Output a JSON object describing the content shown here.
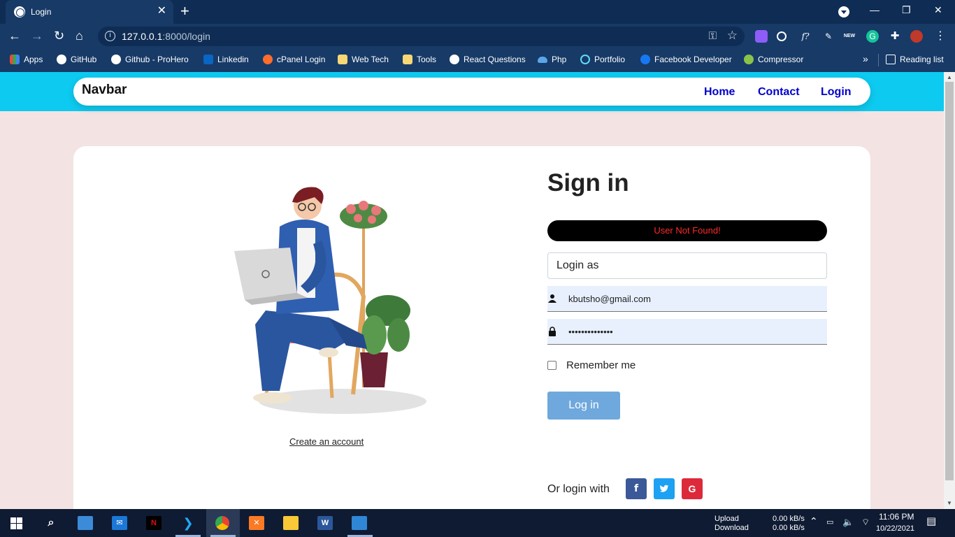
{
  "browser": {
    "tab_title": "Login",
    "tab_close": "✕",
    "new_tab": "+",
    "url_host": "127.0.0.1",
    "url_path": ":8000/login",
    "window_controls": [
      "—",
      "❐",
      "✕"
    ]
  },
  "bookmarks": {
    "items": [
      {
        "label": "Apps",
        "icon": "apps-grid-icon",
        "color": "#e84a3c"
      },
      {
        "label": "GitHub",
        "icon": "github-icon",
        "color": "#ffffff"
      },
      {
        "label": "Github - ProHero",
        "icon": "github-icon",
        "color": "#ffffff"
      },
      {
        "label": "Linkedin",
        "icon": "linkedin-icon",
        "color": "#0a66c2"
      },
      {
        "label": "cPanel Login",
        "icon": "cpanel-icon",
        "color": "#ff6c2c"
      },
      {
        "label": "Web Tech",
        "icon": "folder-icon",
        "color": "#f8d775"
      },
      {
        "label": "Tools",
        "icon": "folder-icon",
        "color": "#f8d775"
      },
      {
        "label": "React Questions",
        "icon": "github-icon",
        "color": "#ffffff"
      },
      {
        "label": "Php",
        "icon": "cloud-icon",
        "color": "#5aa7e8"
      },
      {
        "label": "Portfolio",
        "icon": "react-icon",
        "color": "#61dafb"
      },
      {
        "label": "Facebook Developer",
        "icon": "facebook-icon",
        "color": "#1877f2"
      },
      {
        "label": "Compressor",
        "icon": "compressor-icon",
        "color": "#8bc34a"
      }
    ],
    "more": "»",
    "reading_list": "Reading list"
  },
  "navbar": {
    "brand": "Navbar",
    "links": [
      "Home",
      "Contact",
      "Login"
    ]
  },
  "login": {
    "title": "Sign in",
    "alert": "User Not Found!",
    "login_as": "Login as",
    "email": "kbutsho@gmail.com",
    "password": "••••••••••••••",
    "remember": "Remember me",
    "button": "Log in",
    "create_account": "Create an account",
    "or_login_with": "Or login with",
    "social": [
      {
        "label": "f",
        "color": "#3b5998"
      },
      {
        "label": "t",
        "color": "#1da1f2"
      },
      {
        "label": "G",
        "color": "#dd2a3b"
      }
    ]
  },
  "taskbar": {
    "upload": "Upload",
    "download": "Download",
    "up_rate": "0.00 kB/s",
    "down_rate": "0.00 kB/s",
    "time": "11:06 PM",
    "date": "10/22/2021"
  },
  "colors": {
    "navband": "#0dcaf0",
    "link": "#0000cc",
    "page_bg": "#f3e3e3",
    "button": "#6fa8dc"
  }
}
